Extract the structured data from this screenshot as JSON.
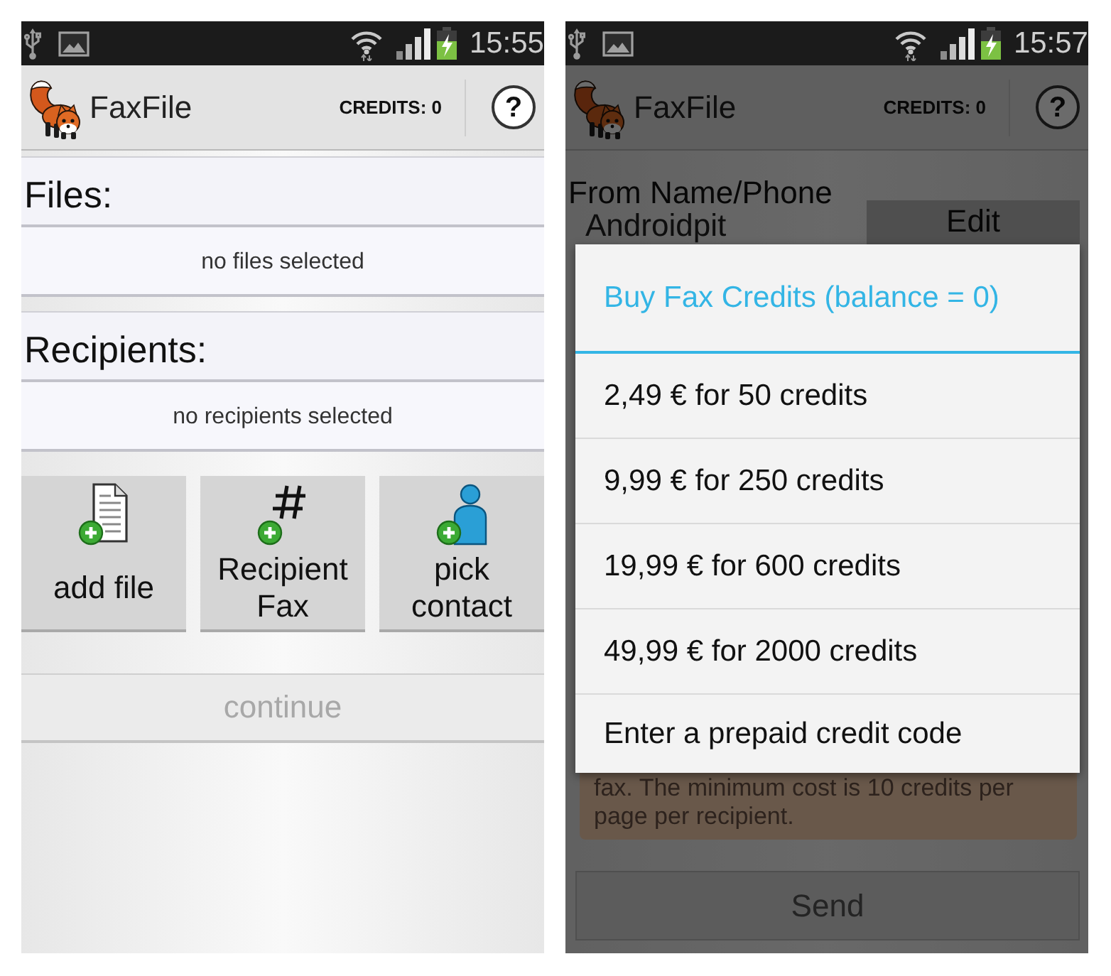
{
  "screens": [
    {
      "status_bar": {
        "time": "15:55"
      },
      "app_bar": {
        "title": "FaxFile",
        "credits": "CREDITS: 0",
        "help_button": "?"
      },
      "sections": [
        {
          "heading": "Files:",
          "empty_text": "no files selected"
        },
        {
          "heading": "Recipients:",
          "empty_text": "no recipients selected"
        }
      ],
      "actions": [
        {
          "kind": "file",
          "label": "add file"
        },
        {
          "kind": "fax_number",
          "label": "Recipient Fax"
        },
        {
          "kind": "contact",
          "label": "pick contact"
        }
      ],
      "continue_button": {
        "label": "continue",
        "disabled": true
      }
    },
    {
      "status_bar": {
        "time": "15:57"
      },
      "app_bar": {
        "title": "FaxFile",
        "credits": "CREDITS: 0",
        "help_button": "?"
      },
      "sender": {
        "label": "From Name/Phone",
        "value": "Androidpit",
        "edit_button": "Edit"
      },
      "notice": "fax. The minimum cost is 10 credits per page per recipient.",
      "send_button": {
        "label": "Send",
        "disabled": true
      },
      "dialog": {
        "title": "Buy Fax Credits (balance = 0)",
        "options": [
          "2,49 € for 50 credits",
          "9,99 € for 250 credits",
          "19,99 € for 600 credits",
          "49,99 € for 2000 credits",
          "Enter a prepaid credit code"
        ]
      }
    }
  ]
}
